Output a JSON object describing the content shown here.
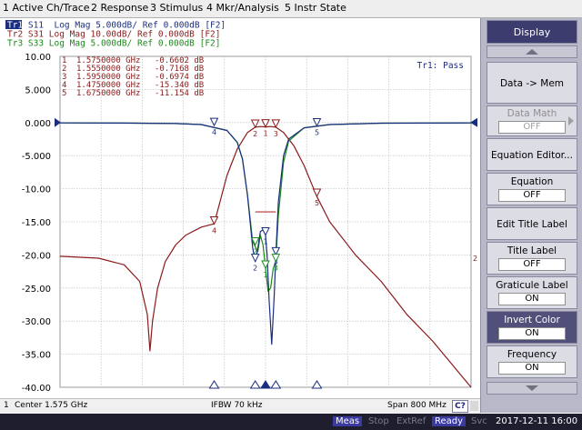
{
  "menu": [
    "1 Active Ch/Trace",
    "2 Response",
    "3 Stimulus",
    "4 Mkr/Analysis",
    "5 Instr State"
  ],
  "traces": [
    {
      "id": "Tr1",
      "label": "Tr1  S11  Log Mag 5.000dB/ Ref 0.000dB [F2]",
      "color": "#1a2e80"
    },
    {
      "id": "Tr2",
      "label": "Tr2  S31  Log Mag 10.00dB/ Ref 0.000dB [F2]",
      "color": "#8b1a1a"
    },
    {
      "id": "Tr3",
      "label": "Tr3  S33  Log Mag 5.000dB/ Ref 0.000dB [F2]",
      "color": "#1a8a1a"
    }
  ],
  "pass_text": "Tr1: Pass",
  "markers": [
    {
      "num": "1",
      "freq": "1.5750000 GHz",
      "val": "-0.6602 dB"
    },
    {
      "num": "2",
      "freq": "1.5550000 GHz",
      "val": "-0.7168 dB"
    },
    {
      "num": "3",
      "freq": "1.5950000 GHz",
      "val": "-0.6974 dB"
    },
    {
      "num": "4",
      "freq": "1.4750000 GHz",
      "val": "-15.340 dB"
    },
    {
      "num": "5",
      "freq": "1.6750000 GHz",
      "val": "-11.154 dB"
    }
  ],
  "chart_data": {
    "type": "line",
    "ylim": [
      -40,
      10
    ],
    "xlim": [
      1.175,
      1.975
    ],
    "y_ticks": [
      "10.00",
      "5.000",
      "0.000",
      "-5.000",
      "-10.00",
      "-15.00",
      "-20.00",
      "-25.00",
      "-30.00",
      "-35.00",
      "-40.00"
    ],
    "series": [
      {
        "name": "Tr1",
        "color": "#1a2e80",
        "x": [
          1.175,
          1.3,
          1.4,
          1.45,
          1.5,
          1.52,
          1.53,
          1.54,
          1.55,
          1.555,
          1.56,
          1.565,
          1.57,
          1.575,
          1.578,
          1.582,
          1.587,
          1.592,
          1.595,
          1.6,
          1.61,
          1.62,
          1.65,
          1.7,
          1.8,
          1.975
        ],
        "y": [
          -0.05,
          -0.08,
          -0.15,
          -0.3,
          -1.2,
          -3,
          -5.5,
          -11,
          -19,
          -21,
          -19,
          -16.5,
          -16.2,
          -17,
          -20,
          -27,
          -33.5,
          -26,
          -20,
          -12,
          -5,
          -2.5,
          -0.8,
          -0.3,
          -0.1,
          -0.05
        ]
      },
      {
        "name": "Tr3",
        "color": "#1a8a1a",
        "x": [
          1.175,
          1.3,
          1.4,
          1.45,
          1.5,
          1.52,
          1.53,
          1.54,
          1.55,
          1.56,
          1.565,
          1.57,
          1.575,
          1.58,
          1.585,
          1.59,
          1.595,
          1.6,
          1.61,
          1.62,
          1.65,
          1.7,
          1.8,
          1.975
        ],
        "y": [
          -0.05,
          -0.08,
          -0.15,
          -0.3,
          -1.2,
          -3,
          -5.5,
          -11,
          -18,
          -19.5,
          -17,
          -18.5,
          -22,
          -25.5,
          -25,
          -22,
          -21,
          -14,
          -6,
          -2.8,
          -0.8,
          -0.3,
          -0.1,
          -0.05
        ]
      },
      {
        "name": "Tr2",
        "color": "#8b1a1a",
        "x": [
          1.175,
          1.25,
          1.3,
          1.33,
          1.345,
          1.35,
          1.355,
          1.365,
          1.38,
          1.4,
          1.42,
          1.45,
          1.475,
          1.5,
          1.52,
          1.54,
          1.555,
          1.565,
          1.575,
          1.585,
          1.595,
          1.61,
          1.63,
          1.65,
          1.675,
          1.7,
          1.75,
          1.8,
          1.85,
          1.9,
          1.975
        ],
        "y": [
          -20.2,
          -20.5,
          -21.5,
          -24,
          -29,
          -34.5,
          -30,
          -25,
          -21,
          -18.5,
          -17,
          -15.8,
          -15.3,
          -8,
          -4,
          -1.5,
          -0.7,
          -0.6,
          -0.66,
          -0.6,
          -0.7,
          -1.5,
          -3.5,
          -6.5,
          -11.2,
          -15,
          -20,
          -24,
          -29,
          -33,
          -40
        ]
      }
    ],
    "marker_points": [
      {
        "trace": "Tr2",
        "num": "1",
        "x": 1.575,
        "y": -0.66
      },
      {
        "trace": "Tr2",
        "num": "2",
        "x": 1.555,
        "y": -0.72
      },
      {
        "trace": "Tr2",
        "num": "3",
        "x": 1.595,
        "y": -0.7
      },
      {
        "trace": "Tr2",
        "num": "4",
        "x": 1.475,
        "y": -15.34
      },
      {
        "trace": "Tr2",
        "num": "5",
        "x": 1.675,
        "y": -11.15
      },
      {
        "trace": "Tr1",
        "num": "1",
        "x": 1.575,
        "y": -17.0
      },
      {
        "trace": "Tr1",
        "num": "2",
        "x": 1.555,
        "y": -21.0
      },
      {
        "trace": "Tr1",
        "num": "3",
        "x": 1.595,
        "y": -20.0
      },
      {
        "trace": "Tr1",
        "num": "4",
        "x": 1.475,
        "y": -0.45
      },
      {
        "trace": "Tr1",
        "num": "5",
        "x": 1.675,
        "y": -0.5
      },
      {
        "trace": "Tr3",
        "num": "1",
        "x": 1.575,
        "y": -22.0
      },
      {
        "trace": "Tr3",
        "num": "2",
        "x": 1.555,
        "y": -18.5
      },
      {
        "trace": "Tr3",
        "num": "3",
        "x": 1.595,
        "y": -21.0
      }
    ],
    "limit_line": {
      "x1": 1.555,
      "x2": 1.595,
      "y": -13.5,
      "color": "#b03030"
    },
    "bottom_marker_x": [
      1.475,
      1.555,
      1.575,
      1.595,
      1.675
    ]
  },
  "infobar": {
    "channel": "1",
    "center": "Center 1.575 GHz",
    "ifbw": "IFBW 70 kHz",
    "span": "Span 800 MHz",
    "c2": "C?"
  },
  "softkeys": {
    "display": "Display",
    "data_mem": "Data -> Mem",
    "data_math": "Data Math",
    "data_math_val": "OFF",
    "equation_editor": "Equation Editor...",
    "equation": "Equation",
    "equation_val": "OFF",
    "edit_title_label": "Edit Title Label",
    "title_label": "Title Label",
    "title_label_val": "OFF",
    "graticule_label": "Graticule Label",
    "graticule_label_val": "ON",
    "invert_color": "Invert Color",
    "invert_color_val": "ON",
    "frequency": "Frequency",
    "frequency_val": "ON"
  },
  "status": {
    "meas": "Meas",
    "stop": "Stop",
    "extref": "ExtRef",
    "ready": "Ready",
    "svc": "Svc",
    "datetime": "2017-12-11 16:00"
  }
}
